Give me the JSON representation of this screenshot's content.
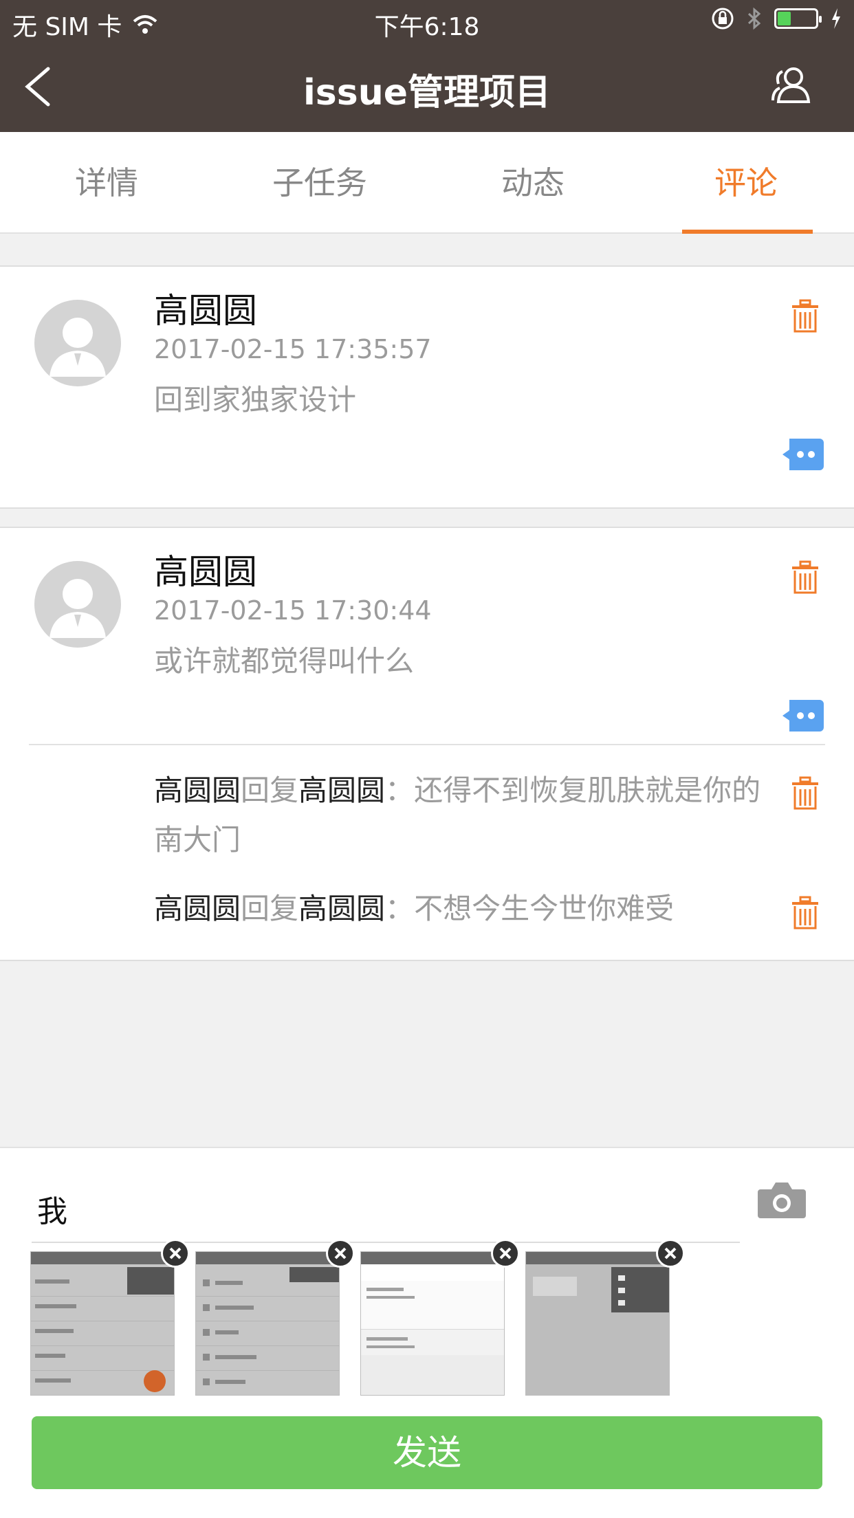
{
  "status_bar": {
    "carrier": "无 SIM 卡",
    "time": "下午6:18",
    "battery_level": 0.35
  },
  "nav": {
    "title": "issue管理项目",
    "back_icon": "chevron-left-icon",
    "members_icon": "people-icon"
  },
  "tabs": [
    {
      "label": "详情"
    },
    {
      "label": "子任务"
    },
    {
      "label": "动态"
    },
    {
      "label": "评论",
      "active": true
    }
  ],
  "comments": [
    {
      "author": "高圆圆",
      "time": "2017-02-15 17:35:57",
      "content": "回到家独家设计"
    },
    {
      "author": "高圆圆",
      "time": "2017-02-15 17:30:44",
      "content": "或许就都觉得叫什么",
      "replies": [
        {
          "from": "高圆圆",
          "verb": "回复",
          "to": "高圆圆",
          "sep": "：",
          "text": "还得不到恢复肌肤就是你的南大门"
        },
        {
          "from": "高圆圆",
          "verb": "回复",
          "to": "高圆圆",
          "sep": "：",
          "text": "不想今生今世你难受"
        }
      ]
    }
  ],
  "composer": {
    "input_value": "我",
    "send_label": "发送",
    "thumb_count": 4
  },
  "colors": {
    "nav_bg": "#4a403c",
    "accent": "#f07b2a",
    "reply_icon": "#5aa2f0",
    "send_bg": "#6ec85e"
  }
}
